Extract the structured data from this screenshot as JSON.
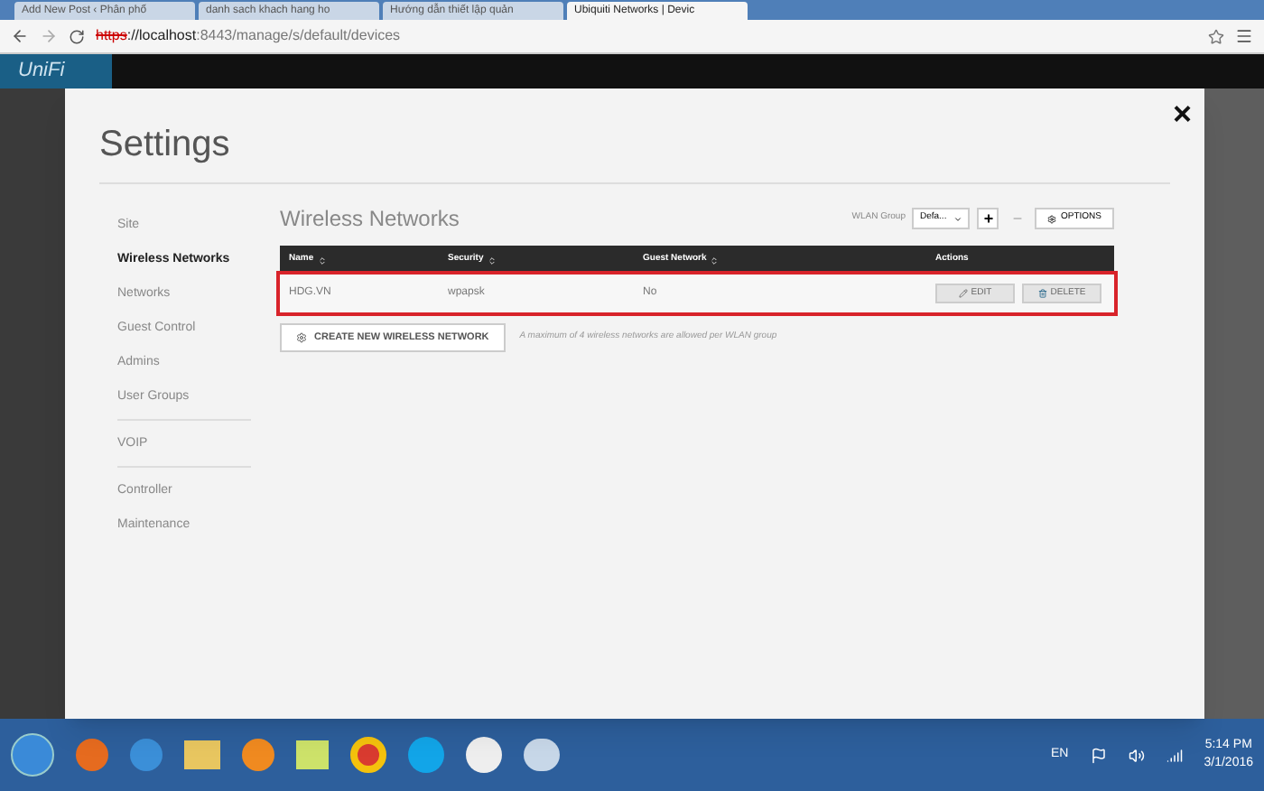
{
  "browser": {
    "tabs": [
      {
        "title": "Add New Post ‹ Phân phố",
        "selected": false
      },
      {
        "title": "danh sach khach hang ho",
        "selected": false
      },
      {
        "title": "Hướng dẫn thiết lập quản",
        "selected": false
      },
      {
        "title": "Ubiquiti Networks | Devic",
        "selected": true
      }
    ],
    "url_scheme": "https",
    "url_host": "://localhost",
    "url_rest": ":8443/manage/s/default/devices"
  },
  "app": {
    "logo": "UniFi"
  },
  "settings": {
    "title": "Settings",
    "close": "×",
    "nav_groups": [
      {
        "items": [
          {
            "label": "Site",
            "selected": false
          },
          {
            "label": "Wireless Networks",
            "selected": true
          },
          {
            "label": "Networks",
            "selected": false
          },
          {
            "label": "Guest Control",
            "selected": false
          },
          {
            "label": "Admins",
            "selected": false
          },
          {
            "label": "User Groups",
            "selected": false
          }
        ]
      },
      {
        "items": [
          {
            "label": "VOIP",
            "selected": false
          }
        ]
      },
      {
        "items": [
          {
            "label": "Controller",
            "selected": false
          },
          {
            "label": "Maintenance",
            "selected": false
          }
        ]
      }
    ],
    "section_title": "Wireless Networks",
    "wlan_group_label": "WLAN Group",
    "wlan_group_value": "Defa...",
    "add": "+",
    "remove": "−",
    "options": "OPTIONS",
    "table": {
      "columns": [
        "Name",
        "Security",
        "Guest Network",
        "Actions"
      ],
      "rows": [
        {
          "name": "HDG.VN",
          "security": "wpapsk",
          "guest": "No",
          "highlighted": true,
          "actions": [
            "EDIT",
            "DELETE"
          ]
        }
      ]
    },
    "create_button": "CREATE NEW WIRELESS NETWORK",
    "note": "A maximum of 4 wireless networks are allowed per WLAN group"
  },
  "taskbar": {
    "language": "EN",
    "time": "5:14 PM",
    "date": "3/1/2016"
  }
}
